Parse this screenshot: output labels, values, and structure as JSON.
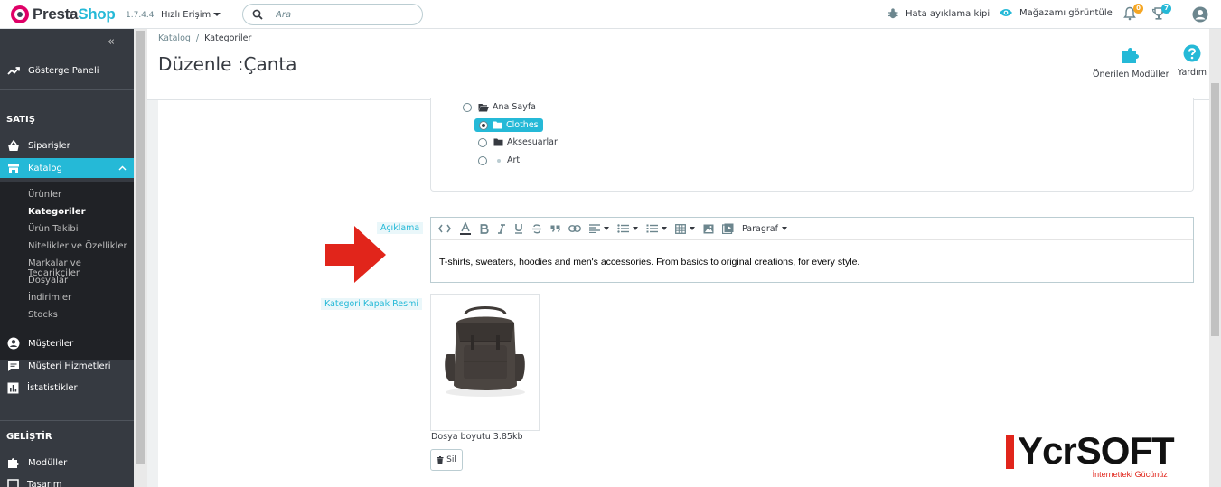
{
  "topbar": {
    "logo_prefix": "Presta",
    "logo_suffix": "Shop",
    "version": "1.7.4.4",
    "quick_access": "Hızlı Erişim",
    "search_placeholder": "Ara",
    "debug_mode": "Hata ayıklama kipi",
    "view_shop": "Mağazamı görüntüle",
    "notifications_count": "0",
    "trophy_count": "7",
    "colors": {
      "brand": "#25b9d7",
      "logo_pink": "#df0067",
      "badge": "#f5a623"
    }
  },
  "sidebar": {
    "collapse_glyph": "«",
    "dashboard": "Gösterge Paneli",
    "section_sell": "SATIŞ",
    "orders": "Siparişler",
    "catalog": "Katalog",
    "catalog_children": [
      "Ürünler",
      "Kategoriler",
      "Ürün Takibi",
      "Nitelikler ve Özellikler",
      "Markalar ve Tedarikçiler",
      "Dosyalar",
      "İndirimler",
      "Stocks"
    ],
    "customers": "Müşteriler",
    "customer_service": "Müşteri Hizmetleri",
    "stats": "İstatistikler",
    "section_improve": "GELİŞTİR",
    "modules": "Modüller",
    "design": "Tasarım"
  },
  "header": {
    "breadcrumb_parent": "Katalog",
    "breadcrumb_sep": "/",
    "breadcrumb_current": "Kategoriler",
    "title": "Düzenle :Çanta",
    "recommended_modules": "Önerilen Modüller",
    "help": "Yardım"
  },
  "tree": {
    "root": "Ana Sayfa",
    "selected": "Clothes",
    "item2": "Aksesuarlar",
    "item3": "Art"
  },
  "description": {
    "label": "Açıklama",
    "paragraph_style": "Paragraf",
    "text": "T-shirts, sweaters, hoodies and men's accessories. From basics to original creations, for every style."
  },
  "cover_image": {
    "label": "Kategori Kapak Resmi",
    "file_size": "Dosya boyutu 3.85kb",
    "delete_label": "Sil"
  },
  "watermark": {
    "brand": "YcrSOFT",
    "tagline": "İnternetteki Gücünüz"
  }
}
